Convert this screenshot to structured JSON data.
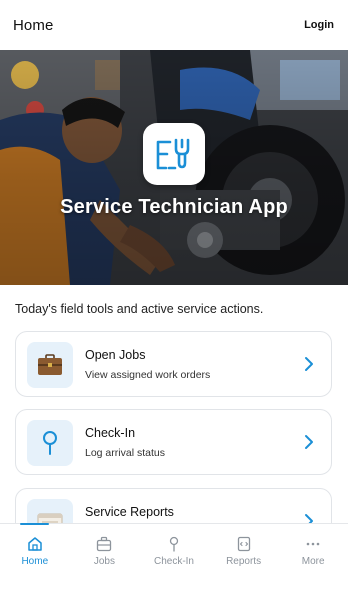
{
  "header": {
    "title": "Home",
    "login_label": "Login"
  },
  "hero": {
    "app_title": "Service Technician App",
    "app_icon": "wrench-toolbox-icon"
  },
  "subtitle": "Today's field tools and active service actions.",
  "cards": [
    {
      "title": "Open Jobs",
      "description": "View assigned work orders",
      "icon": "briefcase-icon"
    },
    {
      "title": "Check-In",
      "description": "Log arrival status",
      "icon": "location-pin-icon"
    },
    {
      "title": "Service Reports",
      "description": "",
      "icon": "report-calendar-icon"
    }
  ],
  "nav": [
    {
      "label": "Home",
      "icon": "home-icon",
      "active": true
    },
    {
      "label": "Jobs",
      "icon": "briefcase-icon",
      "active": false
    },
    {
      "label": "Check-In",
      "icon": "pin-icon",
      "active": false
    },
    {
      "label": "Reports",
      "icon": "document-icon",
      "active": false
    },
    {
      "label": "More",
      "icon": "more-icon",
      "active": false
    }
  ],
  "colors": {
    "accent": "#1b8fd6",
    "icon_bg": "#e6f1fa",
    "border": "#e1e4e8"
  }
}
